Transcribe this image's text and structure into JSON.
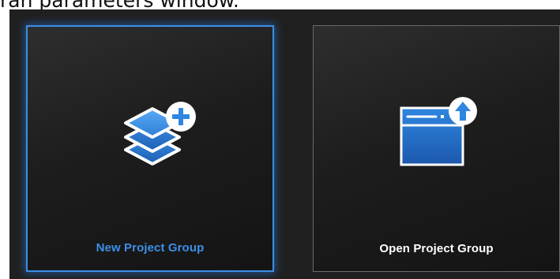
{
  "caption": "ran parameters window.",
  "colors": {
    "accent": "#3d8ee6",
    "background": "#202020",
    "card_border": "#6a6a6a",
    "label_selected": "#3d8fe8",
    "label_normal": "#ffffff"
  },
  "cards": [
    {
      "label": "New Project Group",
      "icon": "stacked-layers-plus-icon",
      "selected": true
    },
    {
      "label": "Open Project Group",
      "icon": "window-upload-icon",
      "selected": false
    }
  ]
}
